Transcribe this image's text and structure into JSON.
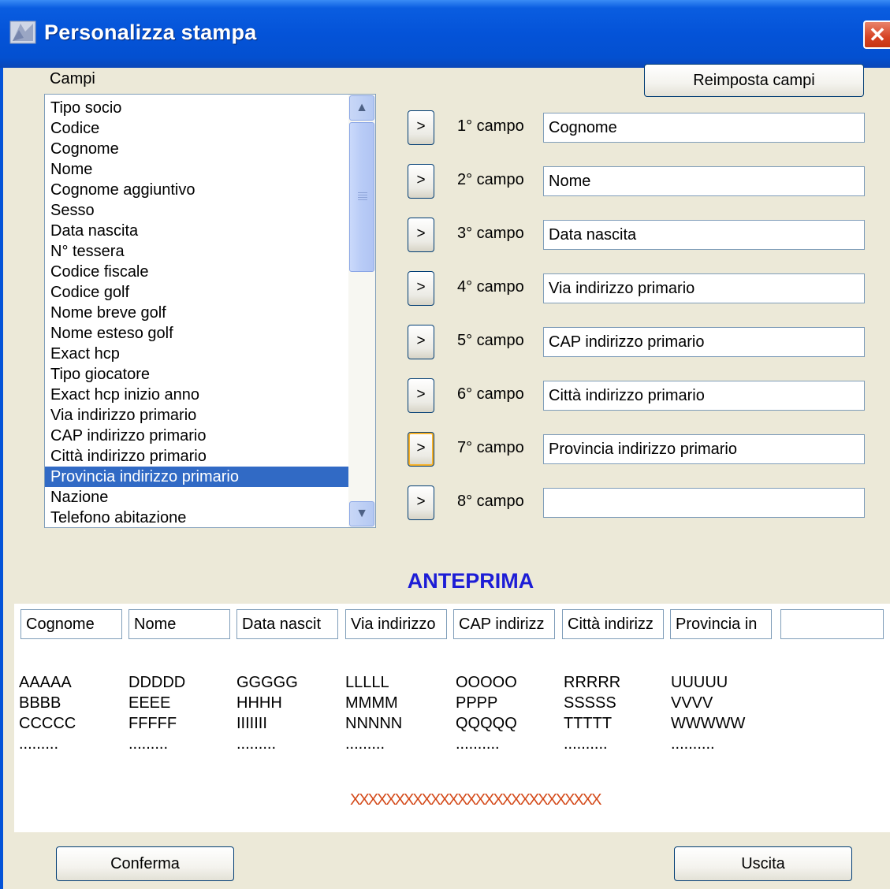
{
  "window": {
    "title": "Personalizza stampa",
    "close_label": "✕"
  },
  "campi_label": "Campi",
  "reset_button": "Reimposta campi",
  "fields_list": {
    "items": [
      "Tipo socio",
      "Codice",
      "Cognome",
      "Nome",
      "Cognome aggiuntivo",
      "Sesso",
      "Data nascita",
      "N° tessera",
      "Codice fiscale",
      "Codice golf",
      "Nome breve golf",
      "Nome esteso golf",
      "Exact hcp",
      "Tipo giocatore",
      "Exact hcp inizio anno",
      "Via indirizzo primario",
      "CAP indirizzo primario",
      "Città indirizzo primario",
      "Provincia indirizzo primario",
      "Nazione",
      "Telefono abitazione"
    ],
    "selected": "Provincia indirizzo primario"
  },
  "add_button_label": ">",
  "selected_fields": [
    {
      "label": "1° campo",
      "value": "Cognome"
    },
    {
      "label": "2° campo",
      "value": "Nome"
    },
    {
      "label": "3° campo",
      "value": "Data nascita"
    },
    {
      "label": "4° campo",
      "value": "Via indirizzo primario"
    },
    {
      "label": "5° campo",
      "value": "CAP indirizzo primario"
    },
    {
      "label": "6° campo",
      "value": "Città indirizzo primario"
    },
    {
      "label": "7° campo",
      "value": "Provincia indirizzo primario"
    },
    {
      "label": "8° campo",
      "value": ""
    }
  ],
  "preview": {
    "title": "ANTEPRIMA",
    "headers": [
      "Cognome",
      "Nome",
      "Data nascit",
      "Via indirizzo",
      "CAP indirizz",
      "Città indirizz",
      "Provincia in",
      ""
    ],
    "columns": [
      [
        "AAAAA",
        "BBBB",
        "CCCCC",
        "........."
      ],
      [
        "DDDDD",
        "EEEE",
        "FFFFF",
        "........."
      ],
      [
        "GGGGG",
        "HHHH",
        "IIIIIII",
        "........."
      ],
      [
        "LLLLL",
        "MMMM",
        "NNNNN",
        "........."
      ],
      [
        "OOOOO",
        "PPPP",
        "QQQQQ",
        ".........."
      ],
      [
        "RRRRR",
        "SSSSS",
        "TTTTT",
        ".........."
      ],
      [
        "UUUUU",
        "VVVV",
        "WWWWW",
        ".........."
      ]
    ],
    "separator": "XXXXXXXXXXXXXXXXXXXXXXXXXXXX"
  },
  "confirm_button": "Conferma",
  "exit_button": "Uscita",
  "colors": {
    "titlebar": "#0453d8",
    "selection": "#316ac5",
    "anteprima": "#1d1dd6",
    "separator": "#d44a1a"
  }
}
